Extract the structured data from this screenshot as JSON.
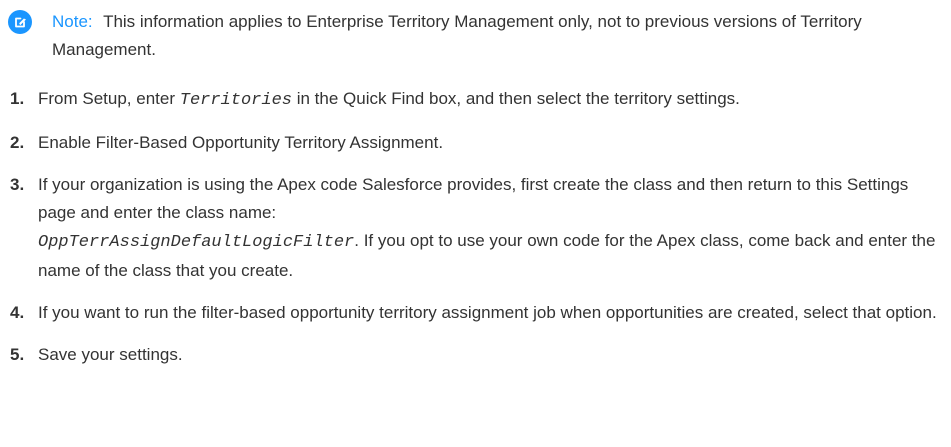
{
  "note": {
    "icon": "edit-note-icon",
    "label": "Note:",
    "text": "This information applies to Enterprise Territory Management only, not to previous versions of Territory Management."
  },
  "steps": [
    {
      "number": "1.",
      "before": "From Setup, enter",
      "code": "Territories",
      "after": "in the Quick Find box, and then select the territory settings."
    },
    {
      "number": "2.",
      "text": "Enable Filter-Based Opportunity Territory Assignment."
    },
    {
      "number": "3.",
      "before": "If your organization is using the Apex code Salesforce provides, first create the class and then return to this Settings page and enter the class name:",
      "code": "OppTerrAssignDefaultLogicFilter",
      "after": ". If you opt to use your own code for the Apex class, come back and enter the name of the class that you create."
    },
    {
      "number": "4.",
      "text": "If you want to run the filter-based opportunity territory assignment job when opportunities are created, select that option."
    },
    {
      "number": "5.",
      "text": "Save your settings."
    }
  ],
  "colors": {
    "accent": "#1b96ff",
    "text": "#333333"
  }
}
